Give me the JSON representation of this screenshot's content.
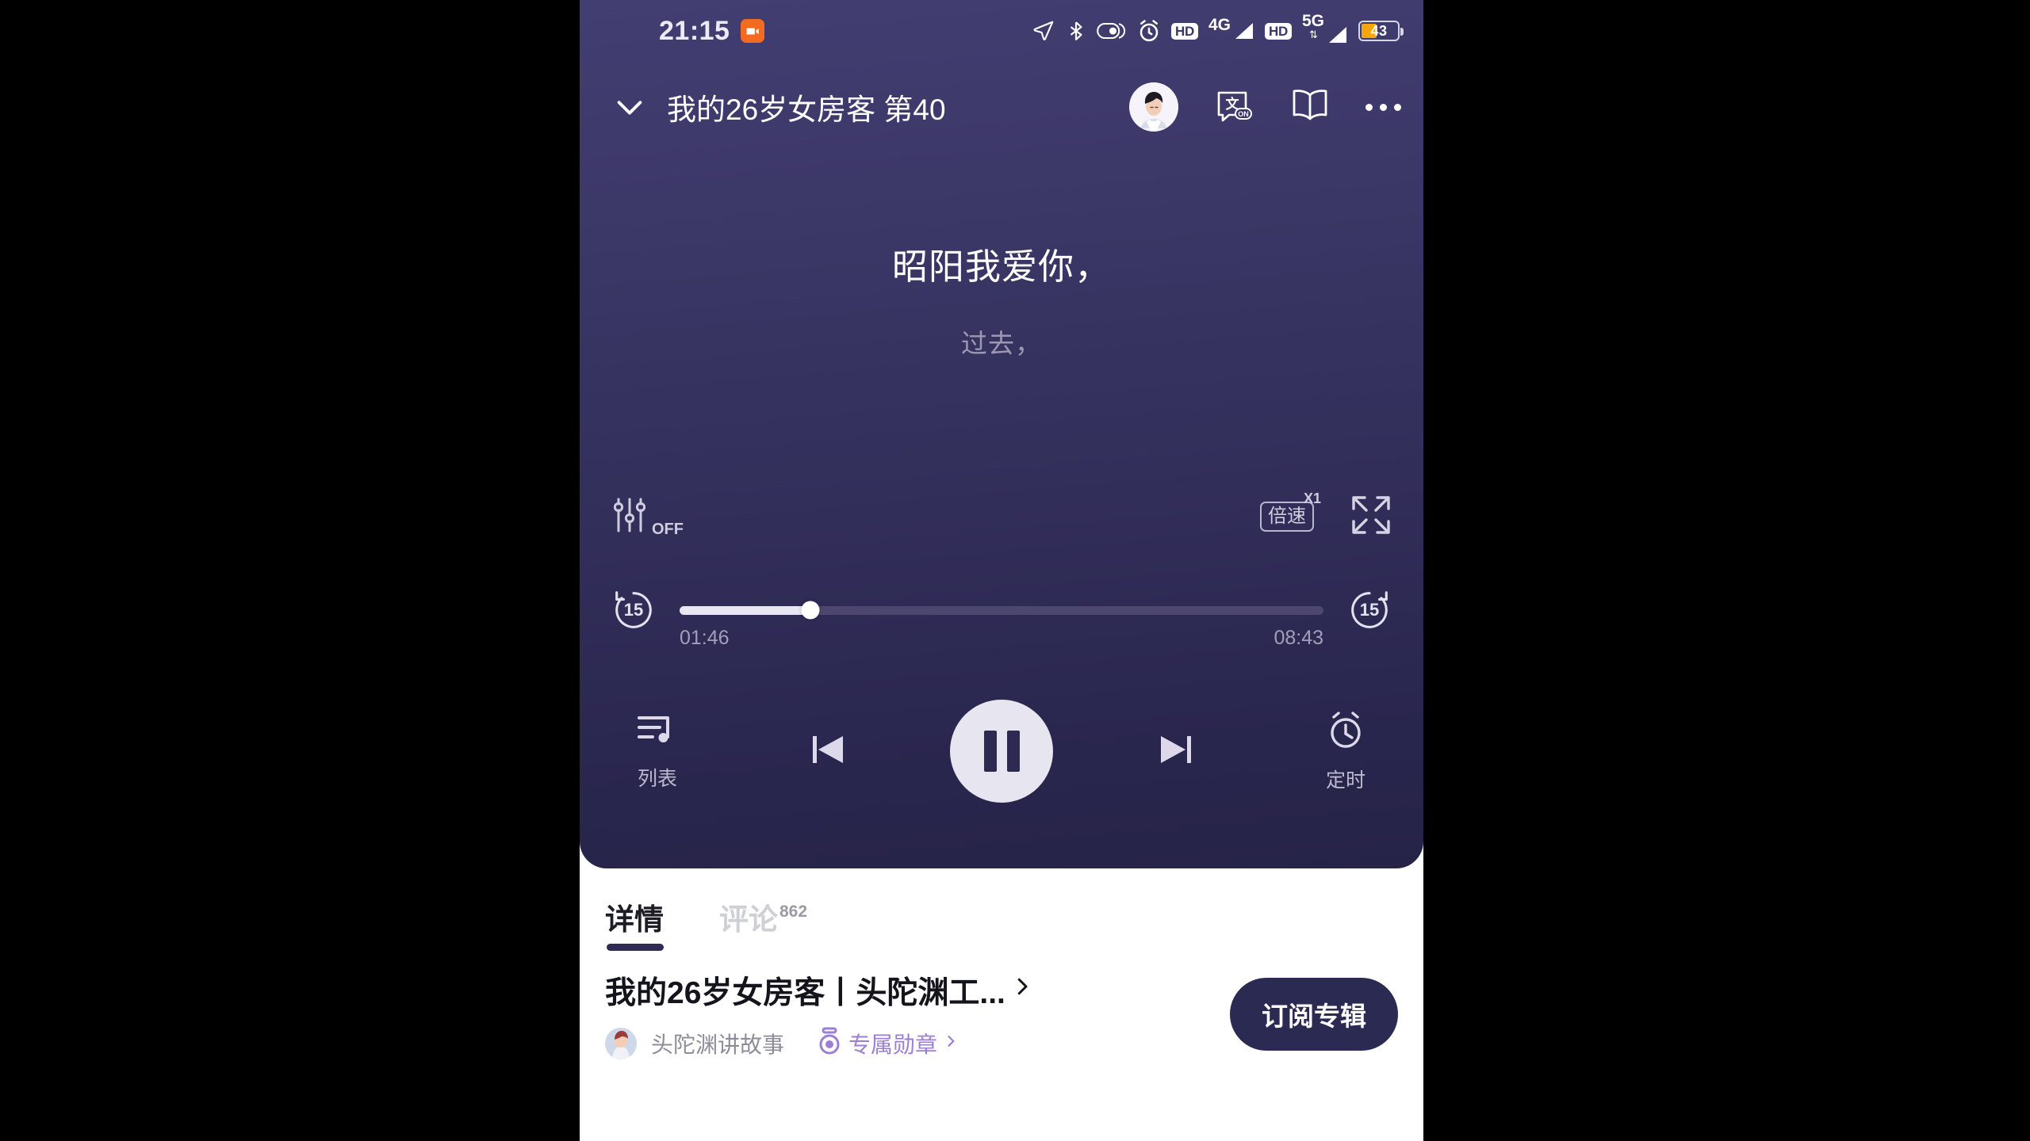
{
  "statusbar": {
    "time": "21:15",
    "recording_icon": "video-record-icon",
    "icons": [
      "location-arrow-icon",
      "bluetooth-icon",
      "do-not-disturb-icon",
      "alarm-clock-icon",
      "hd-icon",
      "signal-4g-icon",
      "hd-icon-2",
      "signal-5g-icon"
    ],
    "network_4g": "4G",
    "network_5g": "5G",
    "hd_label": "HD",
    "battery_percent": "43",
    "battery_level": 43,
    "battery_color": "#f6a609"
  },
  "titlebar": {
    "collapse_icon": "chevron-down-icon",
    "title": "我的26岁女房客 第40",
    "avatar": "user-avatar",
    "translate_icon_label": "ON",
    "icons": [
      "subtitle-on-icon",
      "book-icon",
      "more-options-icon"
    ]
  },
  "lyrics": {
    "current": "昭阳我爱你，",
    "next": "过去，"
  },
  "midrow": {
    "eq_label": "OFF",
    "eq_icon": "equalizer-icon",
    "speed_label": "倍速",
    "speed_value": "X1",
    "fullscreen_icon": "fullscreen-icon"
  },
  "progress": {
    "skip_back": "15",
    "skip_forward": "15",
    "current_time": "01:46",
    "total_time": "08:43",
    "percent": 20.3
  },
  "transport": {
    "playlist_label": "列表",
    "playlist_icon": "playlist-music-icon",
    "prev_icon": "previous-track-icon",
    "play_state_icon": "pause-icon",
    "next_icon": "next-track-icon",
    "timer_label": "定时",
    "timer_icon": "alarm-timer-icon"
  },
  "sheet": {
    "tabs": [
      {
        "label": "详情",
        "count": "",
        "active": true
      },
      {
        "label": "评论",
        "count": "862",
        "active": false
      }
    ],
    "album": {
      "title": "我的26岁女房客丨头陀渊工...",
      "chevron_icon": "chevron-right-icon",
      "author": "头陀渊讲故事",
      "author_avatar": "author-avatar",
      "badge_label": "专属勋章",
      "badge_icon": "medal-icon",
      "badge_chevron": "chevron-right-small-icon",
      "subscribe_label": "订阅专辑"
    }
  },
  "theme": {
    "panel_top": "#433e72",
    "panel_bottom": "#262347",
    "accent_purple": "#9b7fd4",
    "subscribe_bg": "#2b2a52",
    "tab_underline": "#2e2b54"
  }
}
